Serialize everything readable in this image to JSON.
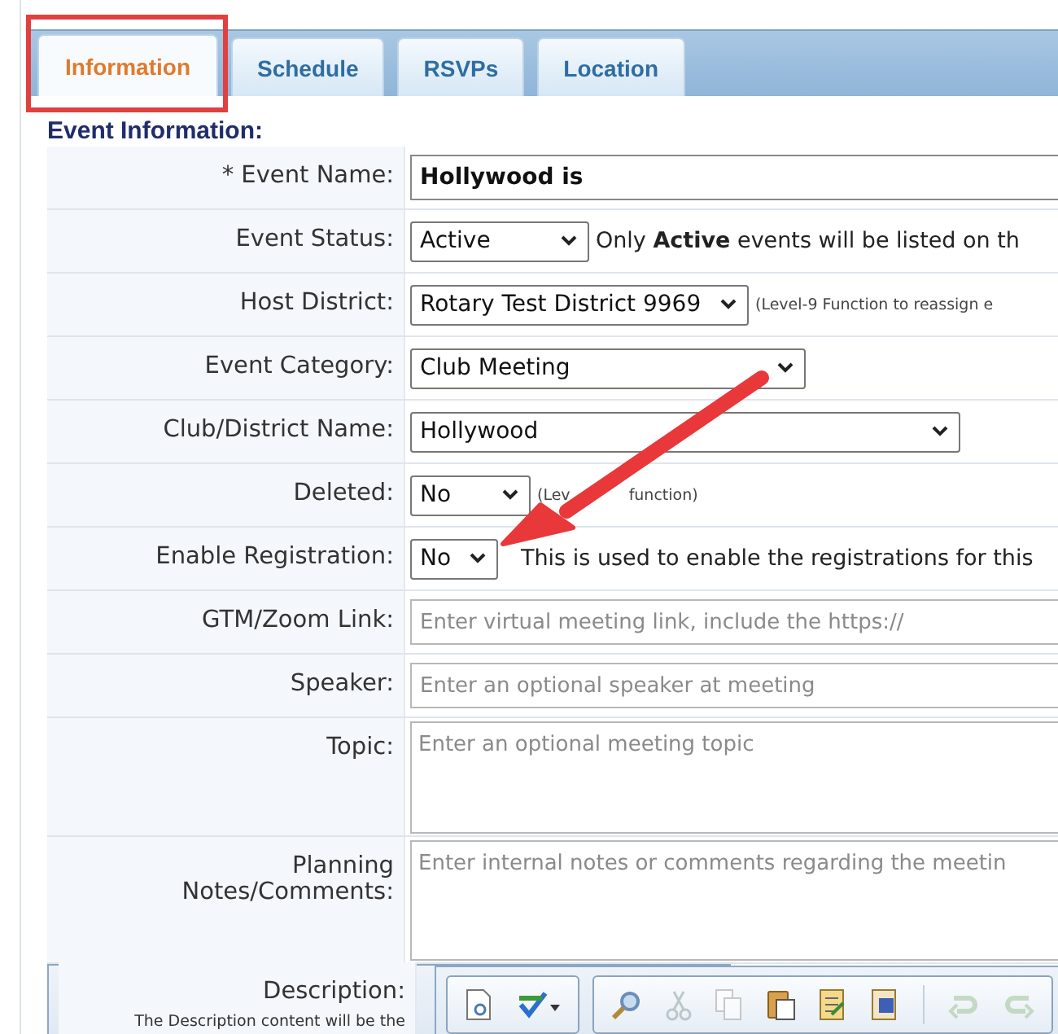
{
  "tabs": [
    {
      "label": "Information",
      "selected": true,
      "highlighted": true
    },
    {
      "label": "Schedule",
      "selected": false,
      "highlighted": false
    },
    {
      "label": "RSVPs",
      "selected": false,
      "highlighted": false
    },
    {
      "label": "Location",
      "selected": false,
      "highlighted": false
    }
  ],
  "section_title": "Event Information:",
  "fields": [
    {
      "kind": "text",
      "label": "* Event Name:",
      "value": "Hollywood is"
    },
    {
      "kind": "select",
      "label": "Event Status:",
      "value": "Active",
      "note": "Only **Active** events will be listed on th",
      "note_small": false
    },
    {
      "kind": "select",
      "label": "Host District:",
      "value": "Rotary Test District 9969",
      "note": "(Level-9 Function to reassign e",
      "note_small": true
    },
    {
      "kind": "select",
      "label": "Event Category:",
      "value": "Club Meeting"
    },
    {
      "kind": "select",
      "label": "Club/District Name:",
      "value": "Hollywood"
    },
    {
      "kind": "select",
      "label": "Deleted:",
      "value": "No",
      "note": "(Lev",
      "note_tail": "function)",
      "note_small": true
    },
    {
      "kind": "select",
      "label": "Enable Registration:",
      "value": "No",
      "note": "This is used to enable the registrations for this",
      "note_small": false
    },
    {
      "kind": "text",
      "label": "GTM/Zoom Link:",
      "placeholder": "Enter virtual meeting link, include the https://"
    },
    {
      "kind": "text",
      "label": "Speaker:",
      "placeholder": "Enter an optional speaker at meeting"
    },
    {
      "kind": "textarea",
      "label": "Topic:",
      "placeholder": "Enter an optional meeting topic"
    },
    {
      "kind": "textarea",
      "label": "Planning Notes/Comments:",
      "placeholder": "Enter internal notes or comments regarding the meetin"
    },
    {
      "kind": "editor",
      "label": "Description:",
      "sublabel": "The Description content will be the"
    }
  ]
}
